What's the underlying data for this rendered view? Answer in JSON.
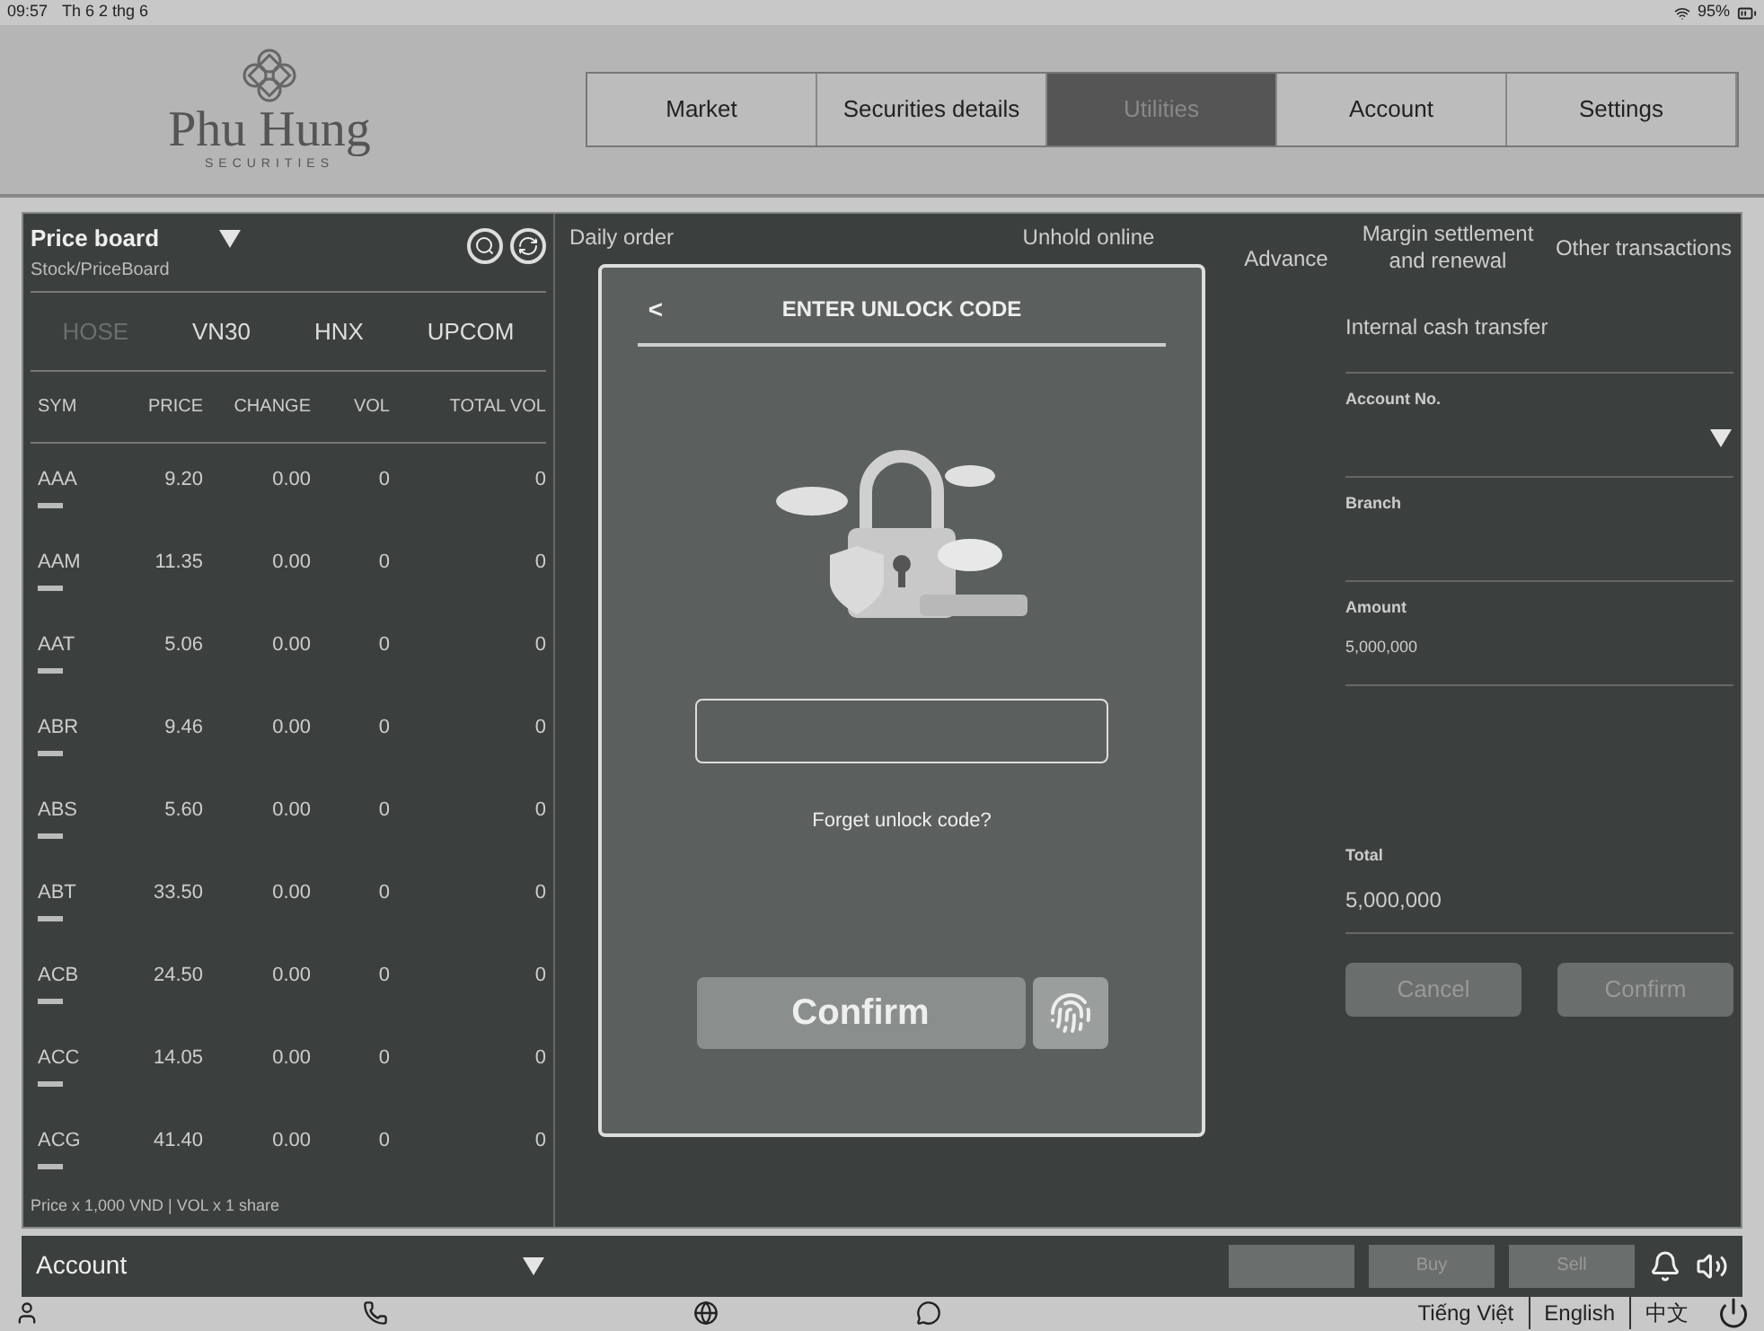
{
  "status_bar": {
    "time": "09:57",
    "date": "Th 6 2 thg 6",
    "battery": "95%"
  },
  "logo": {
    "name": "Phu Hung",
    "tagline": "SECURITIES"
  },
  "nav_tabs": [
    {
      "label": "Market",
      "selected": false
    },
    {
      "label": "Securities details",
      "selected": false
    },
    {
      "label": "Utilities",
      "selected": true
    },
    {
      "label": "Account",
      "selected": false
    },
    {
      "label": "Settings",
      "selected": false
    }
  ],
  "price_board": {
    "title": "Price board",
    "subtitle": "Stock/PriceBoard",
    "exchanges": [
      {
        "label": "HOSE",
        "selected": true
      },
      {
        "label": "VN30",
        "selected": false
      },
      {
        "label": "HNX",
        "selected": false
      },
      {
        "label": "UPCOM",
        "selected": false
      }
    ],
    "columns": [
      "SYM",
      "PRICE",
      "CHANGE",
      "VOL",
      "TOTAL VOL"
    ],
    "rows": [
      {
        "sym": "AAA",
        "price": "9.20",
        "change": "0.00",
        "vol": "0",
        "total_vol": "0"
      },
      {
        "sym": "AAM",
        "price": "11.35",
        "change": "0.00",
        "vol": "0",
        "total_vol": "0"
      },
      {
        "sym": "AAT",
        "price": "5.06",
        "change": "0.00",
        "vol": "0",
        "total_vol": "0"
      },
      {
        "sym": "ABR",
        "price": "9.46",
        "change": "0.00",
        "vol": "0",
        "total_vol": "0"
      },
      {
        "sym": "ABS",
        "price": "5.60",
        "change": "0.00",
        "vol": "0",
        "total_vol": "0"
      },
      {
        "sym": "ABT",
        "price": "33.50",
        "change": "0.00",
        "vol": "0",
        "total_vol": "0"
      },
      {
        "sym": "ACB",
        "price": "24.50",
        "change": "0.00",
        "vol": "0",
        "total_vol": "0"
      },
      {
        "sym": "ACC",
        "price": "14.05",
        "change": "0.00",
        "vol": "0",
        "total_vol": "0"
      },
      {
        "sym": "ACG",
        "price": "41.40",
        "change": "0.00",
        "vol": "0",
        "total_vol": "0"
      }
    ],
    "note": "Price x 1,000 VND | VOL x 1 share"
  },
  "utility_tabs": [
    {
      "label": "Daily order"
    },
    {
      "label": "Unhold online"
    },
    {
      "label": "Advance"
    },
    {
      "label": "Margin settlement and renewal"
    },
    {
      "label": "Other transactions"
    }
  ],
  "transfer_form": {
    "title": "Internal cash transfer",
    "fields": [
      {
        "label": "Account No.",
        "kind": "dropdown"
      },
      {
        "label": "Branch",
        "kind": "text"
      },
      {
        "label": "Amount",
        "value": "5,000,000",
        "kind": "text"
      },
      {
        "label": "Total",
        "value": "5,000,000",
        "kind": "text"
      }
    ],
    "buttons": [
      "Cancel",
      "Confirm"
    ]
  },
  "modal": {
    "title": "ENTER UNLOCK CODE",
    "back": "<",
    "link": "Forget unlock code?",
    "button": "Confirm"
  },
  "account_bar": {
    "label": "Account",
    "buttons": [
      "Buy",
      "Sell"
    ]
  },
  "languages": [
    {
      "label": "Tiếng Việt"
    },
    {
      "label": "English"
    },
    {
      "label": "中文"
    }
  ]
}
